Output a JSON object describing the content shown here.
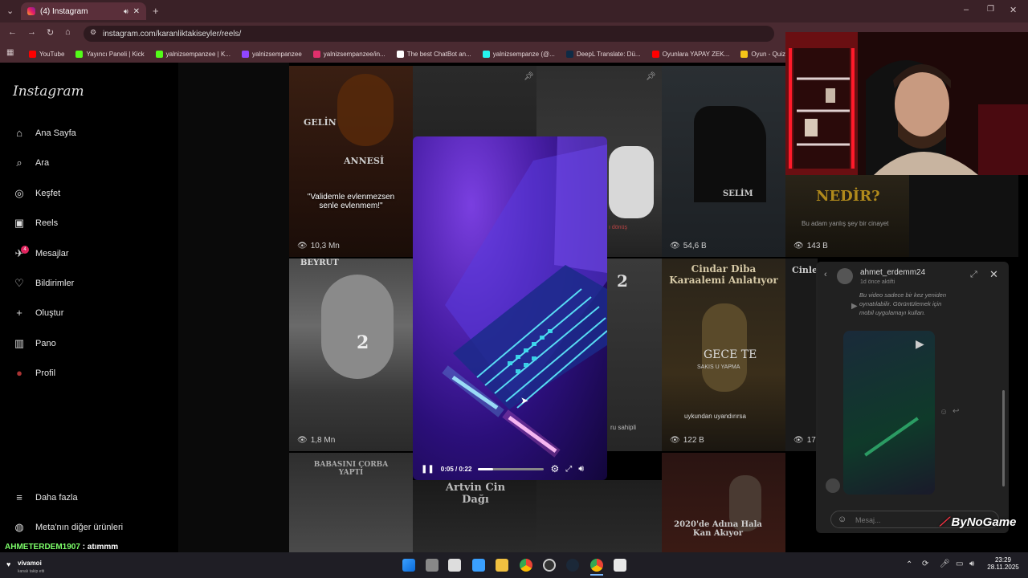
{
  "browser": {
    "tab_title": "(4) Instagram",
    "url": "instagram.com/karanliktakiseyler/reels/",
    "bookmarks": [
      {
        "label": "YouTube",
        "color": "#ff0000"
      },
      {
        "label": "Yayıncı Paneli | Kick",
        "color": "#53fc18"
      },
      {
        "label": "yalnizsempanzee | K...",
        "color": "#53fc18"
      },
      {
        "label": "yalnizsempanzee",
        "color": "#9146ff"
      },
      {
        "label": "yalnizsempanzee/in...",
        "color": "#e1306c"
      },
      {
        "label": "The best ChatBot an...",
        "color": "#ffffff"
      },
      {
        "label": "yalnizsempanze (@...",
        "color": "#25f4ee"
      },
      {
        "label": "DeepL Translate: Dü...",
        "color": "#0f2b46"
      },
      {
        "label": "Oyunlara YAPAY ZEK...",
        "color": "#ff0000"
      },
      {
        "label": "Oyun - Quizei",
        "color": "#f5c518"
      }
    ]
  },
  "sidebar": {
    "logo": "Instagram",
    "items": [
      {
        "label": "Ana Sayfa",
        "icon": "⌂"
      },
      {
        "label": "Ara",
        "icon": "⌕"
      },
      {
        "label": "Keşfet",
        "icon": "◎"
      },
      {
        "label": "Reels",
        "icon": "▣"
      },
      {
        "label": "Mesajlar",
        "icon": "✈"
      },
      {
        "label": "Bildirimler",
        "icon": "♡"
      },
      {
        "label": "Oluştur",
        "icon": "+"
      },
      {
        "label": "Pano",
        "icon": "▥"
      },
      {
        "label": "Profil",
        "icon": "●"
      }
    ],
    "messages_badge": "4",
    "more_label": "Daha fazla",
    "meta_label": "Meta'nın diğer ürünleri"
  },
  "tiles": {
    "t1_top": "GELİN",
    "t1_mid": "ANNESİ",
    "t1_quote": "\"Validemle evlenmezsen senle evlenmem!\"",
    "t1_count": "10,3 Mn",
    "t2_count": "1,8 Mn",
    "t2_top": "BEYRUT",
    "t2_mid": "2",
    "t3_title": "BABASINI ÇORBA YAPTI",
    "t4_title": "Artvin Cin Dağı",
    "t5_sub": "ı dönüş",
    "t5_mid": "2",
    "t5_foot": "ru sahipli",
    "t6_label": "SELİM",
    "t6_count": "54,6 B",
    "t7_title": "Cindar Diba Karaalemi Anlatıyor",
    "t7_mid": "GECE  TE",
    "t7_sub": "SAKIS  U  YAPMA",
    "t7_foot": "uykundan uyandırırsa",
    "t7_count": "122 B",
    "t8_title": "2020'de Adına Hala Kan Akıyor",
    "t9_title": "NEDİR?",
    "t9_sub": "Bu adam yanlış şey bir cinayet",
    "t9_count": "143 B",
    "t10_left": "Cinle",
    "t10_count": "17"
  },
  "video": {
    "time": "0:05 / 0:22",
    "progress": 0.23
  },
  "chat": {
    "username": "ahmet_erdemm24",
    "status": "1d önce aktifti",
    "notice": "Bu video sadece bir kez yeniden oynatılabilir. Görüntülemek için mobil uygulamayı kullan.",
    "placeholder": "Mesaj..."
  },
  "overlay": {
    "chat_user": "AHMETERDEM1907",
    "chat_msg": " : atımmm",
    "brand": "ByNoGame",
    "follower_name": "vivamoi",
    "follower_text": "kanalı takip etti"
  },
  "taskbar": {
    "time": "23:29",
    "date": "28.11.2025"
  }
}
